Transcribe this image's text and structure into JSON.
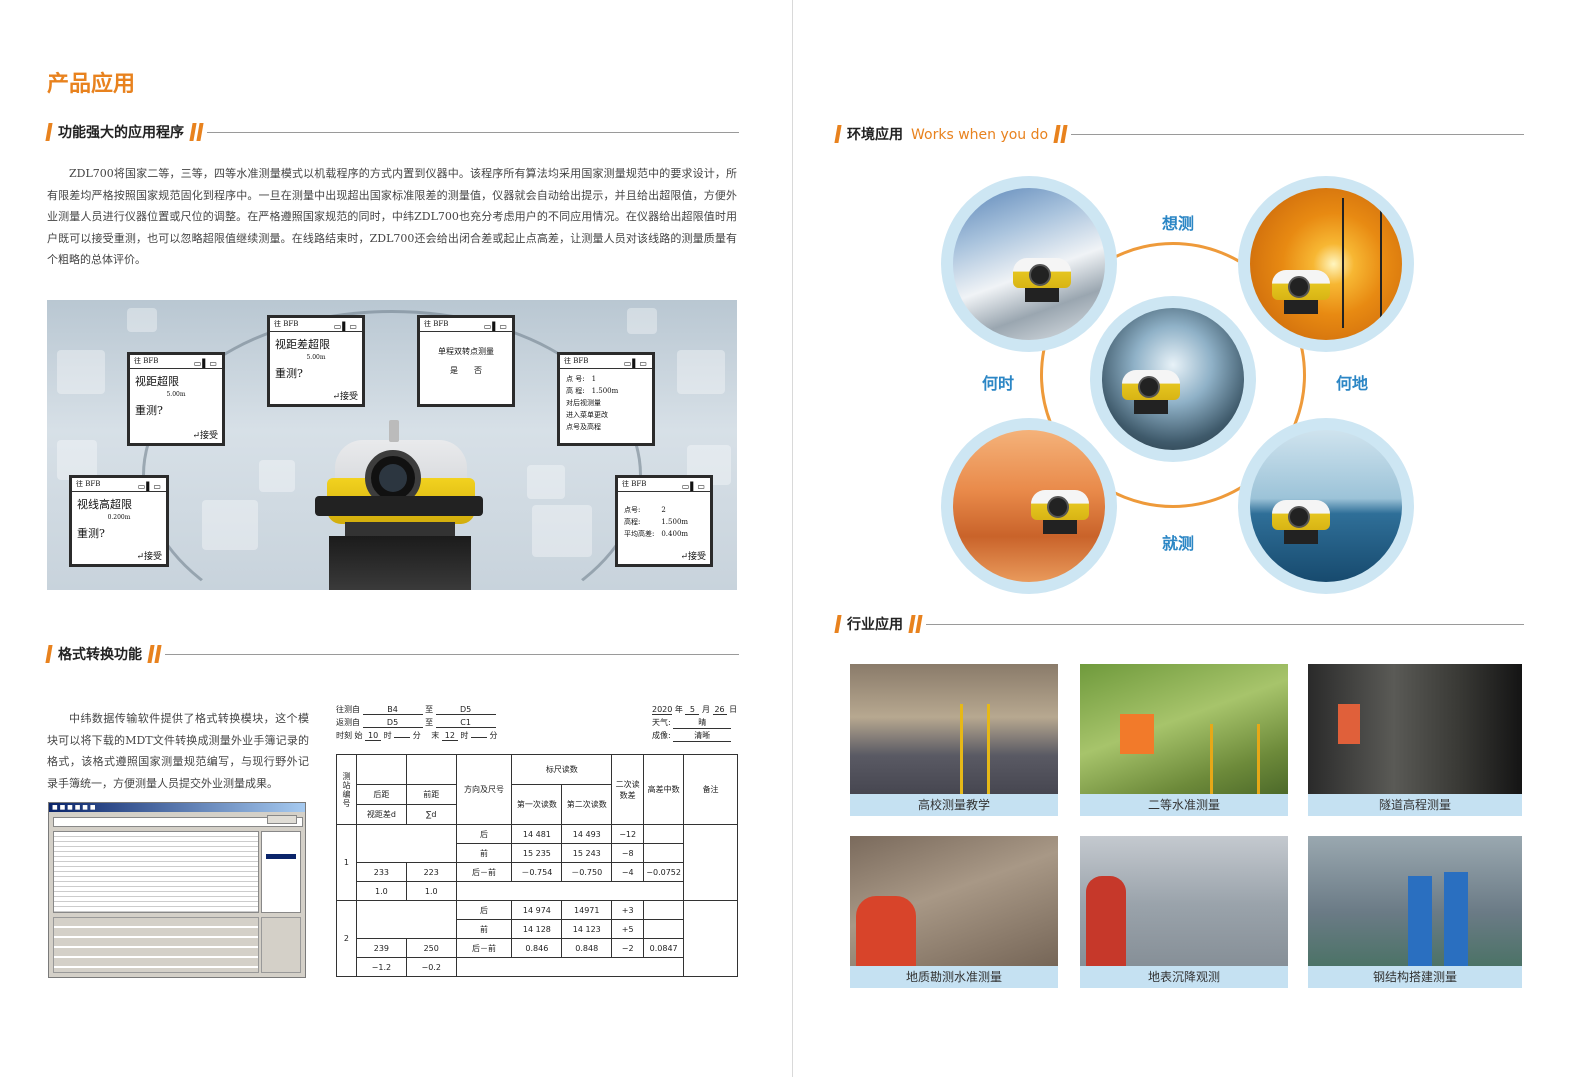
{
  "left_page": {
    "title": "产品应用",
    "section1": {
      "heading": "功能强大的应用程序",
      "body": "ZDL700将国家二等，三等，四等水准测量模式以机载程序的方式内置到仪器中。该程序所有算法均采用国家测量规范中的要求设计，所有限差均严格按照国家规范固化到程序中。一旦在测量中出现超出国家标准限差的测量值，仪器就会自动给出提示，并且给出超限值，方便外业测量人员进行仪器位置或尺位的调整。在严格遵照国家规范的同时，中纬ZDL700也充分考虑用户的不同应用情况。在仪器给出超限值时用户既可以接受重测，也可以忽略超限值继续测量。在线路结束时，ZDL700还会给出闭合差或起止点高差，让测量人员对该线路的测量质量有个粗略的总体评价。"
    },
    "screens": [
      {
        "status": "往 BFB",
        "main": "视距超限",
        "sub": "5.00m",
        "ask": "重测?",
        "action": "接受"
      },
      {
        "status": "往 BFB",
        "main": "视距差超限",
        "sub": "5.00m",
        "ask": "重测?",
        "action": "接受"
      },
      {
        "status": "往 BFB",
        "main": "单程双转点测量",
        "options": "是　　否"
      },
      {
        "status": "往 BFB",
        "lines": [
          "点 号:　1",
          "高 程:　1.500m",
          "对后视测量",
          "进入菜单更改",
          "点号及高程"
        ]
      },
      {
        "status": "往 BFB",
        "main": "视线高超限",
        "sub": "0.200m",
        "ask": "重测?",
        "action": "接受"
      },
      {
        "status": "往 BFB",
        "lines": [
          "点号:　　　2",
          "高程:　　　1.500m",
          "平均高差:　0.400m"
        ],
        "action": "接受"
      }
    ],
    "section2": {
      "heading": "格式转换功能",
      "body": "中纬数据传输软件提供了格式转换模块，这个模块可以将下载的MDT文件转换成测量外业手簿记录的格式，该格式遵照国家测量规范编写，与现行野外记录手簿统一，方便测量人员提交外业测量成果。"
    },
    "form": {
      "from_label": "往测自",
      "from_val": "B4",
      "to_label": "至",
      "to_val": "D5",
      "back_label": "返测自",
      "back_val": "D5",
      "back_to_val": "C1",
      "time_label": "时刻 始",
      "start_h": "10",
      "h": "时",
      "m": "分",
      "end_label": "末",
      "end_h": "12",
      "year": "2020",
      "y": "年",
      "month": "5",
      "mo": "月",
      "day": "26",
      "d": "日",
      "weather_label": "天气:",
      "weather": "晴",
      "image_label": "成像:",
      "image": "清晰"
    },
    "table": {
      "col_station": "测站编号",
      "col_back": "后距",
      "col_front": "前距",
      "col_diff": "视距差d",
      "col_sum": "∑d",
      "col_dir": "方向及尺号",
      "col_read": "标尺读数",
      "col_first": "第一次读数",
      "col_second": "第二次读数",
      "col_delta": "二次读数差",
      "col_mean": "高差中数",
      "col_note": "备注",
      "rows": [
        {
          "station": "1",
          "back": "233",
          "front": "223",
          "diff": "1.0",
          "sum": "1.0",
          "dirs": [
            "后",
            "前",
            "后－前"
          ],
          "first": [
            "14 481",
            "15 235",
            "－0.754"
          ],
          "second": [
            "14 493",
            "15 243",
            "－0.750"
          ],
          "delta": [
            "−12",
            "−8",
            "−4"
          ],
          "mean": "−0.0752"
        },
        {
          "station": "2",
          "back": "239",
          "front": "250",
          "diff": "−1.2",
          "sum": "−0.2",
          "dirs": [
            "后",
            "前",
            "后－前"
          ],
          "first": [
            "14 974",
            "14 128",
            "0.846"
          ],
          "second": [
            "14971",
            "14 123",
            "0.848"
          ],
          "delta": [
            "+3",
            "+5",
            "−2"
          ],
          "mean": "0.0847"
        }
      ]
    }
  },
  "right_page": {
    "section1": {
      "heading": "环境应用",
      "heading_en": "Works when you do"
    },
    "words": {
      "top": "想测",
      "left": "何时",
      "right": "何地",
      "bottom": "就测"
    },
    "section2": {
      "heading": "行业应用"
    },
    "photos": [
      "高校测量教学",
      "二等水准测量",
      "隧道高程测量",
      "地质勘测水准测量",
      "地表沉降观测",
      "钢结构搭建测量"
    ]
  },
  "colors": {
    "accent": "#e8821e",
    "blue": "#2b86c5",
    "caption": "#c5e1f2"
  }
}
